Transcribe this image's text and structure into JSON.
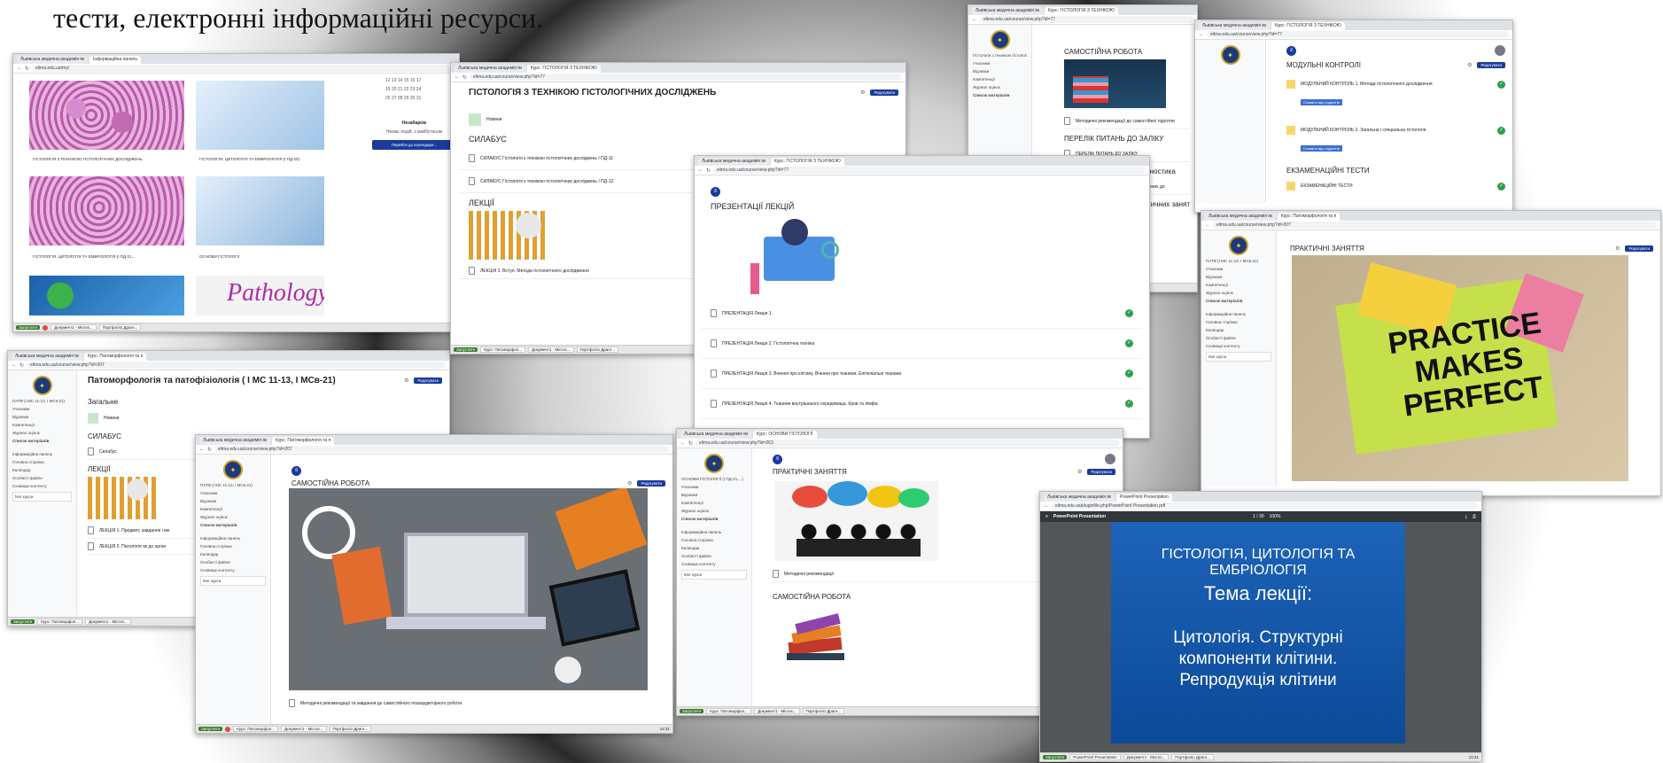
{
  "slide_text": "тести, електронні інформаційні ресурси.",
  "w1": {
    "tabs": [
      "Львівська медична академія ім",
      "Інформаційна панель"
    ],
    "url": "elima.edu.ua/my/",
    "cards": [
      "ГІСТОЛОГІЯ З ТЕХНІКОЮ ГІСТОЛОГІЧНИХ ДОСЛІДЖЕНЬ",
      "ГІСТОЛОГІЯ, ЦИТОЛОГІЯ ТА ЕМБРІОЛОГІЯ (І ПД-20)",
      "ГІСТОЛОГІЯ, ЦИТОЛОГІЯ ТА ЕМБРІОЛОГІЯ (І ПД-21,...",
      "ОСНОВИ ГІСТОЛОГІЇ"
    ],
    "pathology_text": "Pathology",
    "calendar_rows": [
      "12 13 14 15 16 17",
      "19 20 21 22 23 24",
      "26 27 28 29 30 31"
    ],
    "upcoming_title": "Незабаром",
    "upcoming_text": "Немає подій, з майбутньом",
    "calendar_button": "Перейти до календаря..."
  },
  "w2": {
    "tabs": [
      "Львівська медична академія ім",
      "Курс: ГІСТОЛОГІЯ З ТЕХНІКОЮ"
    ],
    "url": "elima.edu.ua/course/view.php?id=77",
    "title": "ГІСТОЛОГІЯ З ТЕХНІКОЮ ГІСТОЛОГІЧНИХ ДОСЛІДЖЕНЬ",
    "edit": "Редагувати",
    "news": "Новини",
    "syllabus": "СИЛАБУС",
    "items": [
      "СИЛАБУС Гістологія з технікою гістологічних досліджень І ПД-11",
      "СИЛАБУС Гістологія з технікою гістологічних досліджень І ПД-12"
    ],
    "lectures": "ЛЕКЦІЇ",
    "lecture1": "ЛЕКЦІЯ 1. Вступ. Методи гістологічного дослідження"
  },
  "w3": {
    "tabs": [
      "Львівська медична академія ім",
      "Курс: ГІСТОЛОГІЯ З ТЕХНІКОЮ"
    ],
    "url": "elima.edu.ua/course/view.php?id=77",
    "title": "ПРЕЗЕНТАЦІЇ ЛЕКЦІЙ",
    "items": [
      "ПРЕЗЕНТАЦІЯ Лекція 1.",
      "ПРЕЗЕНТАЦІЯ Лекція 2. Гістологічна техніка",
      "ПРЕЗЕНТАЦІЯ Лекція 3. Вчення про клітину. Вчення про тканини. Епітеліальні тканини",
      "ПРЕЗЕНТАЦІЯ Лекція 4. Тканини внутрішнього середовища. Кров та лімфа"
    ]
  },
  "w4": {
    "tabs": [
      "Львівська медична академія ім",
      "Курс: ГІСТОЛОГІЯ З ТЕХНІКОЮ"
    ],
    "url": "elima.edu.ua/course/view.php?id=77",
    "sec1": "САМОСТІЙНА РОБОТА",
    "item1": "Методичні рекомендації до самостійної підготов",
    "sec2": "ПЕРЕЛІК ПИТАНЬ ДО ЗАЛІКУ",
    "item2": "ПЕРЕЛІК ПИТАНЬ ДО ЗАЛІКУ",
    "sec3": "КРОК М Лабораторна діагностика",
    "item3": "КРОК М Гістологія з технік. гістологічних до",
    "sec4": "Тестові завдання до практичних занят",
    "side": [
      "Гістологія з технікою гістологічних досліджень",
      "Учасники",
      "Відзнаки",
      "Компетенції",
      "Журнал оцінок",
      "Список матеріалів"
    ]
  },
  "w5": {
    "tabs": [
      "Львівська медична академія ім",
      "Курс: ГІСТОЛОГІЯ З ТЕХНІКОЮ"
    ],
    "url": "elima.edu.ua/course/view.php?id=77",
    "sec1": "МОДУЛЬНІ КОНТРОЛІ",
    "mod1": "МОДУЛЬНИЙ КОНТРОЛЬ 1. Методи гістологічного дослідження",
    "mod2": "МОДУЛЬНИЙ КОНТРОЛЬ 2. Загальна і спеціальна гістологія",
    "restr": "Сховано від студентів",
    "sec2": "ЕКЗАМЕНАЦІЙНІ ТЕСТИ",
    "exam": "ЕКЗАМЕНАЦІЙНІ ТЕСТИ",
    "edit": "Редагувати"
  },
  "w6": {
    "tabs": [
      "Львівська медична академія ім",
      "Курс: Патоморфологія та п"
    ],
    "url": "elima.edu.ua/course/view.php?id=207",
    "title": "ПРАКТИЧНІ ЗАНЯТТЯ",
    "note_lines": [
      "PRACTICE",
      "MAKES",
      "PERFECT"
    ],
    "edit": "Редагувати",
    "side": [
      "ПАТФ (І МС 11-13, І МСв-21)",
      "Учасники",
      "Відзнаки",
      "Компетенції",
      "Журнал оцінок",
      "Список матеріалів",
      "Інформаційна панель",
      "Головна сторінка",
      "Календар",
      "Особисті файли",
      "Сховище контенту",
      "Мої курси"
    ]
  },
  "w7": {
    "tabs": [
      "Львівська медична академія ім",
      "Курс: Патоморфологія та п"
    ],
    "url": "elima.edu.ua/course/view.php?id=207",
    "title": "Патоморфологія та патофізіологія ( І МС 11-13, І МСв-21)",
    "general": "Загальне",
    "news": "Новини",
    "syllabus": "СИЛАБУС",
    "syl_item": "Силабус",
    "lectures": "ЛЕКЦІЇ",
    "lec1": "ЛЕКЦІЯ 1. Предмет, завдання і ме",
    "lec2": "ЛЕКЦІЯ 2. Патологія як до орган",
    "edit": "Редагувати",
    "side": [
      "ПАТФ (І МС 11-13, І МСв-21)",
      "Учасники",
      "Відзнаки",
      "Компетенції",
      "Журнал оцінок",
      "Список матеріалів",
      "Інформаційна панель",
      "Головна сторінка",
      "Календар",
      "Особисті файли",
      "Сховище контенту",
      "Мої курси"
    ]
  },
  "w8": {
    "tabs": [
      "Львівська медична академія ім",
      "Курс: Патоморфологія та п"
    ],
    "url": "elima.edu.ua/course/view.php?id=207",
    "title": "САМОСТІЙНА РОБОТА",
    "edit": "Редагувати",
    "footer_item": "Методичні рекомендації та завдання до самостійного позааудиторного роботи",
    "side": [
      "ПАТФ (І МС 11-13, І МСв-21)",
      "Учасники",
      "Відзнаки",
      "Компетенції",
      "Журнал оцінок",
      "Список матеріалів",
      "Інформаційна панель",
      "Головна сторінка",
      "Календар",
      "Особисті файли",
      "Сховище контенту",
      "Мої курси"
    ]
  },
  "w9": {
    "tabs": [
      "Львівська медична академія ім",
      "Курс: ОСНОВИ ГІСТОЛОГІЇ"
    ],
    "url": "elima.edu.ua/course/view.php?id=263",
    "title": "ПРАКТИЧНІ ЗАНЯТТЯ",
    "item": "Методичні рекомендації",
    "sec2": "САМОСТІЙНА РОБОТА",
    "edit": "Редагувати",
    "side": [
      "ОСНОВИ ГІСТОЛОГІЇ (І ПД-21,...)",
      "Учасники",
      "Відзнаки",
      "Компетенції",
      "Журнал оцінок",
      "Список матеріалів",
      "Інформаційна панель",
      "Головна сторінка",
      "Календар",
      "Особисті файли",
      "Сховище контенту",
      "Мої курси"
    ]
  },
  "w10": {
    "tabs": [
      "Львівська медична академія ім",
      "PowerPoint Presentation"
    ],
    "url": "elima.edu.ua/pluginfile.php/PowerPoint Presentation.pdf",
    "ppt_title": "PowerPoint Presentation",
    "page": "1 / 30",
    "zoom": "100%",
    "slide_l1": "ГІСТОЛОГІЯ, ЦИТОЛОГІЯ ТА",
    "slide_l2": "ЕМБРІОЛОГІЯ",
    "slide_l3": "Тема лекції:",
    "slide_l4": "Цитологія. Структурні",
    "slide_l5": "компоненти клітини.",
    "slide_l6": "Репродукція клітини"
  },
  "taskbar": {
    "start": "Запуститe",
    "b1": "Курс: Патоморфол...",
    "b2": "Документ1 - Micros...",
    "b3": "Портфоліо Драгн...",
    "clock": "12:31"
  },
  "colors": {
    "accent": "#1a3a9c",
    "check": "#2e9e4f",
    "slide": "#1d63b8"
  }
}
